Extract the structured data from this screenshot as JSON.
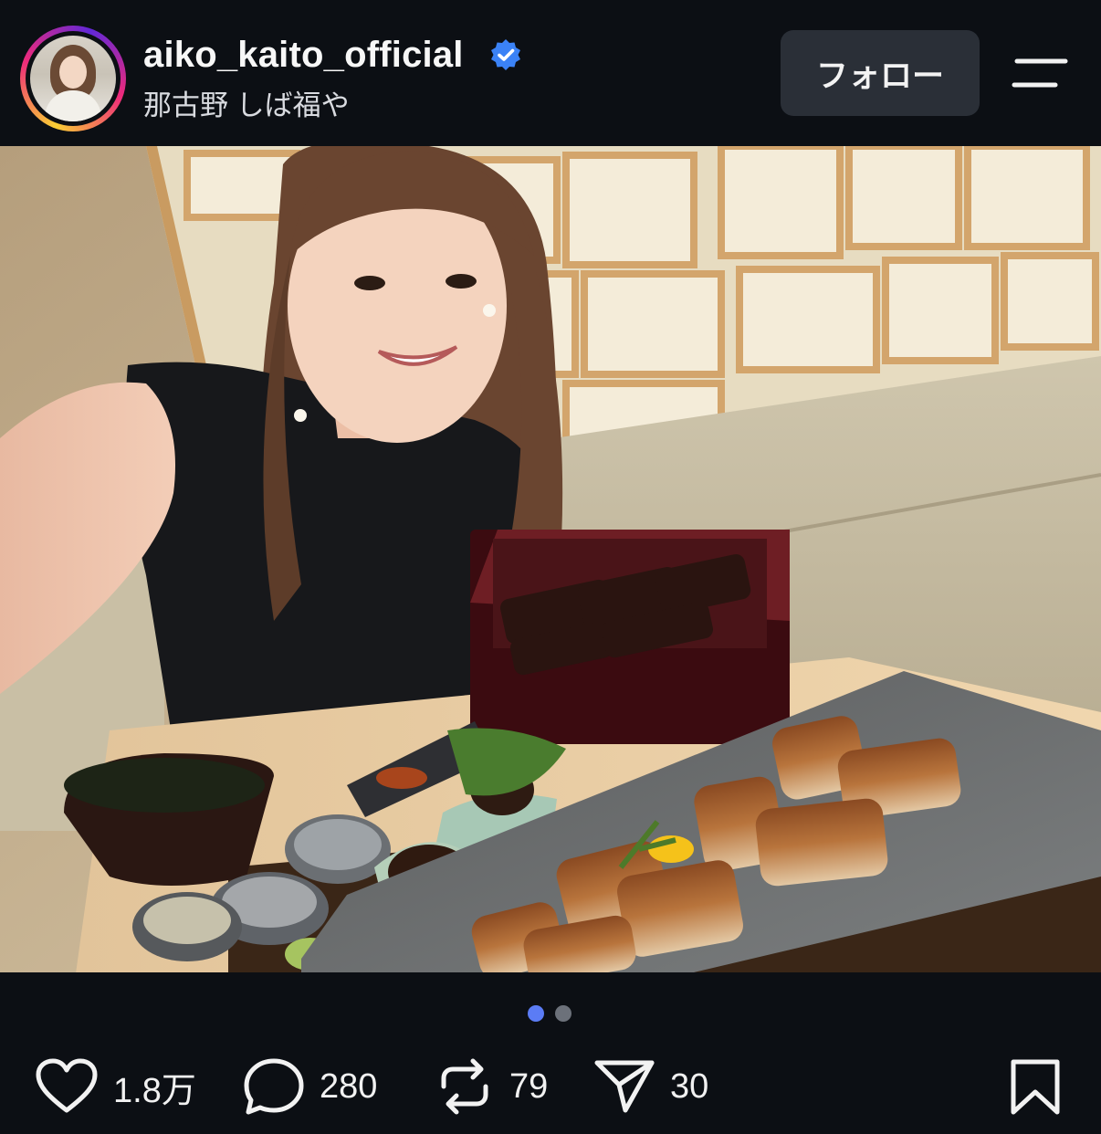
{
  "header": {
    "username": "aiko_kaito_official",
    "location": "那古野 しば福や",
    "follow_label": "フォロー"
  },
  "carousel": {
    "count": 2,
    "active_index": 0
  },
  "actions": {
    "likes": "1.8万",
    "comments": "280",
    "reposts": "79",
    "shares": "30"
  },
  "colors": {
    "background": "#0c0f14",
    "follow_button": "#2a2f37",
    "verified_badge": "#3b82f6",
    "active_dot": "#5b7cf5"
  },
  "icons": [
    "verified-badge-icon",
    "menu-icon",
    "heart-icon",
    "comment-icon",
    "repost-icon",
    "share-icon",
    "bookmark-icon"
  ]
}
